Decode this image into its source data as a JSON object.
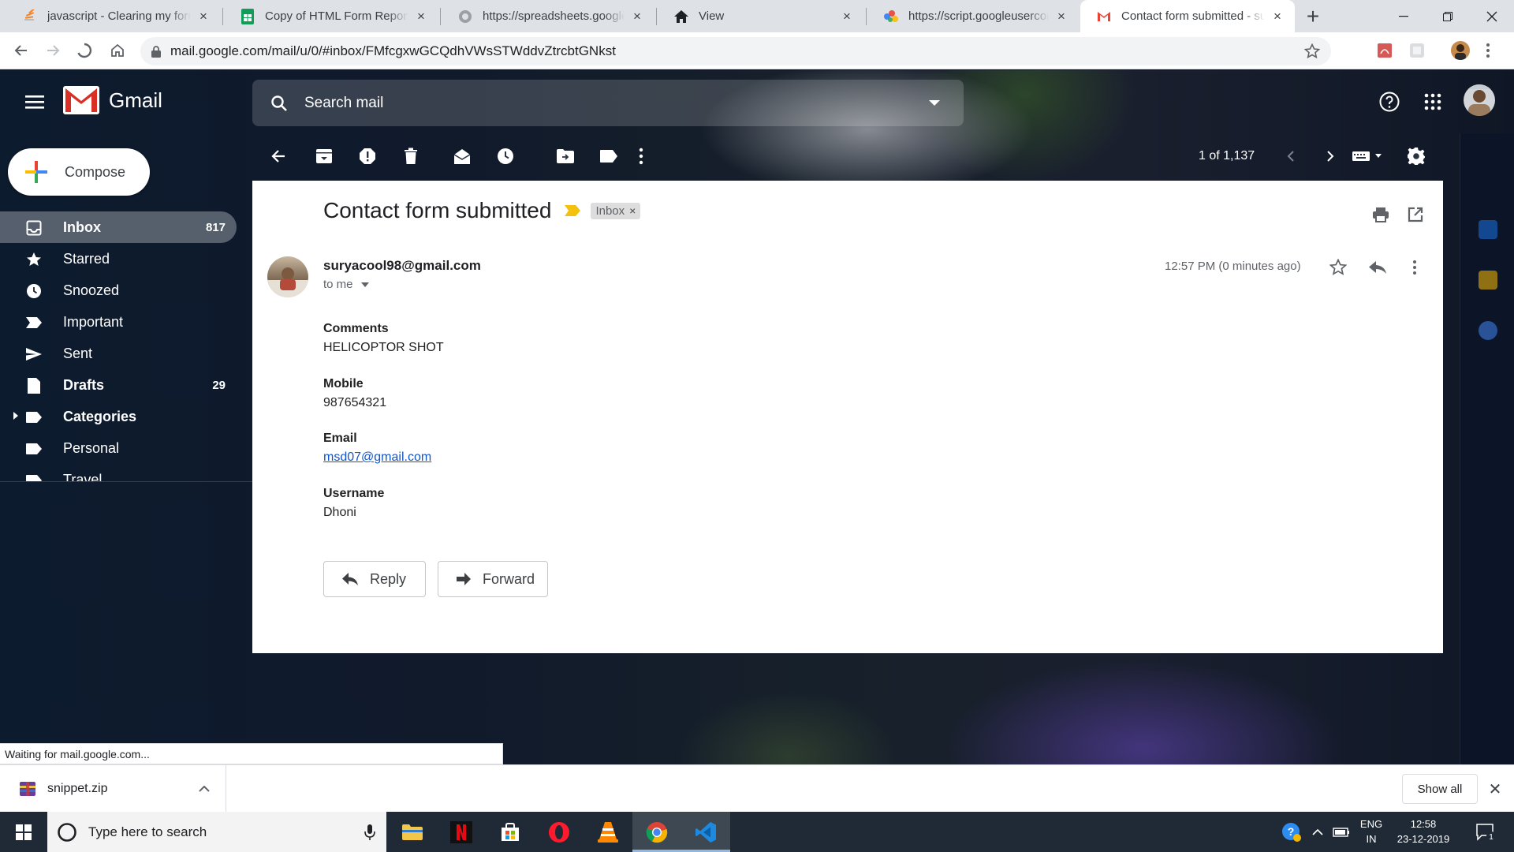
{
  "browser": {
    "tabs": [
      {
        "title": "javascript - Clearing my form",
        "favicon": "stackoverflow-icon",
        "active": false
      },
      {
        "title": "Copy of HTML Form Reponse",
        "favicon": "sheets-icon",
        "active": false
      },
      {
        "title": "https://spreadsheets.google.",
        "favicon": "globe-icon",
        "active": false
      },
      {
        "title": "View",
        "favicon": "home-icon",
        "active": false
      },
      {
        "title": "https://script.googleusercont",
        "favicon": "apps-script-icon",
        "active": false
      },
      {
        "title": "Contact form submitted - sur",
        "favicon": "gmail-icon",
        "active": true
      }
    ],
    "new_tab": "+",
    "address": "mail.google.com/mail/u/0/#inbox/FMfcgxwGCQdhVWsSTWddvZtrcbtGNkst",
    "status_text": "Waiting for mail.google.com..."
  },
  "gmail": {
    "brand": "Gmail",
    "search_placeholder": "Search mail",
    "compose_label": "Compose",
    "nav": [
      {
        "label": "Inbox",
        "count": "817",
        "icon": "inbox-icon",
        "active": true,
        "bold": true
      },
      {
        "label": "Starred",
        "count": "",
        "icon": "star-icon",
        "active": false,
        "bold": false
      },
      {
        "label": "Snoozed",
        "count": "",
        "icon": "clock-icon",
        "active": false,
        "bold": false
      },
      {
        "label": "Important",
        "count": "",
        "icon": "important-icon",
        "active": false,
        "bold": false
      },
      {
        "label": "Sent",
        "count": "",
        "icon": "send-icon",
        "active": false,
        "bold": false
      },
      {
        "label": "Drafts",
        "count": "29",
        "icon": "draft-icon",
        "active": false,
        "bold": true
      },
      {
        "label": "Categories",
        "count": "",
        "icon": "label-icon",
        "active": false,
        "bold": true
      },
      {
        "label": "Personal",
        "count": "",
        "icon": "label-icon",
        "active": false,
        "bold": false
      },
      {
        "label": "Travel",
        "count": "",
        "icon": "label-icon",
        "active": false,
        "bold": false
      }
    ],
    "page_count": "1 of 1,137",
    "message": {
      "subject": "Contact form submitted",
      "label_chip": "Inbox",
      "chip_close": "×",
      "sender": "suryacool98@gmail.com",
      "recipient": "to me",
      "time": "12:57 PM (0 minutes ago)",
      "fields": [
        {
          "label": "Comments",
          "value": "HELICOPTOR SHOT",
          "link": false
        },
        {
          "label": "Mobile",
          "value": "987654321",
          "link": false
        },
        {
          "label": "Email",
          "value": "msd07@gmail.com",
          "link": true
        },
        {
          "label": "Username",
          "value": "Dhoni",
          "link": false
        }
      ],
      "reply_label": "Reply",
      "forward_label": "Forward"
    }
  },
  "downloads": {
    "file": "snippet.zip",
    "show_all": "Show all",
    "close": "✕"
  },
  "taskbar": {
    "search_placeholder": "Type here to search",
    "lang_top": "ENG",
    "lang_bottom": "IN",
    "time": "12:58",
    "date": "23-12-2019",
    "notifications": "1"
  },
  "colors": {
    "gmail_red": "#ea4335",
    "link": "#1155cc",
    "important_yellow": "#f4c20d"
  }
}
